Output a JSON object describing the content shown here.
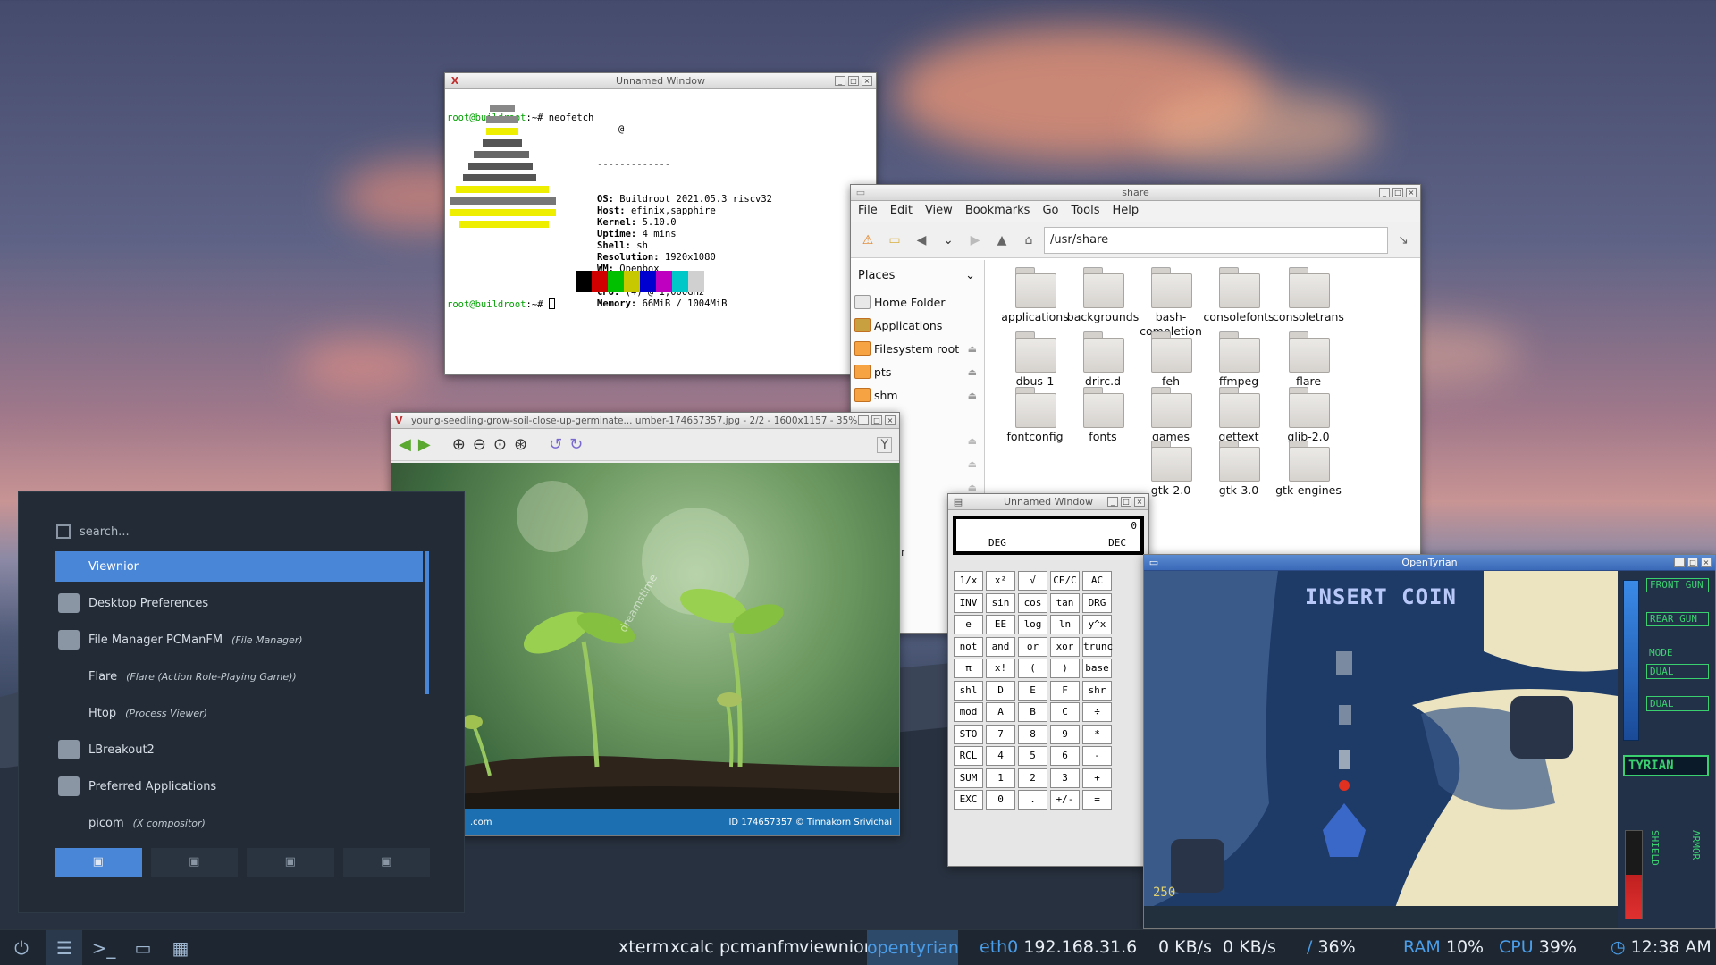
{
  "xterm": {
    "title": "Unnamed Window",
    "prompt1": "root@buildroot",
    "cmd1": ":~# neofetch",
    "at": "@",
    "sep": "-------------",
    "info": [
      [
        "OS:",
        "Buildroot 2021.05.3 riscv32"
      ],
      [
        "Host:",
        "efinix,sapphire"
      ],
      [
        "Kernel:",
        "5.10.0"
      ],
      [
        "Uptime:",
        "4 mins"
      ],
      [
        "Shell:",
        "sh"
      ],
      [
        "Resolution:",
        "1920x1080"
      ],
      [
        "WM:",
        "Openbox"
      ],
      [
        "Terminal:",
        "xterm"
      ],
      [
        "CPU:",
        "(4) @ 1,000GHz"
      ],
      [
        "Memory:",
        "66MiB / 1004MiB"
      ]
    ],
    "prompt2": "root@buildroot",
    "cmd2": ":~# ",
    "palette": [
      "#000000",
      "#d00000",
      "#00c000",
      "#c8c800",
      "#0000d0",
      "#c000c0",
      "#00c8c8",
      "#d0d0d0"
    ]
  },
  "filemanager": {
    "title": "share",
    "menu": [
      "File",
      "Edit",
      "View",
      "Bookmarks",
      "Go",
      "Tools",
      "Help"
    ],
    "path": "/usr/share",
    "places_label": "Places",
    "places": [
      "Home Folder",
      "Applications",
      "Filesystem root",
      "pts",
      "shm"
    ],
    "folders": [
      "applications",
      "backgrounds",
      "bash-\ncompletion",
      "consolefonts",
      "consoletrans",
      "dbus-1",
      "drirc.d",
      "feh",
      "ffmpeg",
      "flare",
      "fontconfig",
      "fonts",
      "games",
      "gettext",
      "glib-2.0",
      "",
      "",
      "gtk-2.0",
      "gtk-3.0",
      "gtk-engines"
    ],
    "partial_label": "r"
  },
  "viewnior": {
    "title": "young-seedling-grow-soil-close-up-germinate... umber-174657357.jpg - 2/2 - 1600x1157 - 35%",
    "watermark": "dreamstime",
    "bar_left": ".com",
    "bar_right": "ID 174657357 © Tinnakorn Srivichai"
  },
  "xcalc": {
    "title": "Unnamed Window",
    "display": "0",
    "deg": "DEG",
    "dec": "DEC",
    "rows": [
      [
        "1/x",
        "x²",
        "√",
        "CE/C",
        "AC"
      ],
      [
        "INV",
        "sin",
        "cos",
        "tan",
        "DRG"
      ],
      [
        "e",
        "EE",
        "log",
        "ln",
        "y^x"
      ],
      [
        "not",
        "and",
        "or",
        "xor",
        "trunc"
      ],
      [
        "π",
        "x!",
        "(",
        ")",
        "base"
      ],
      [
        "shl",
        "D",
        "E",
        "F",
        "shr"
      ],
      [
        "mod",
        "A",
        "B",
        "C",
        "÷"
      ],
      [
        "STO",
        "7",
        "8",
        "9",
        "*"
      ],
      [
        "RCL",
        "4",
        "5",
        "6",
        "-"
      ],
      [
        "SUM",
        "1",
        "2",
        "3",
        "+"
      ],
      [
        "EXC",
        "0",
        ".",
        "+/-",
        "="
      ]
    ]
  },
  "opentyrian": {
    "title": "OpenTyrian",
    "insert_coin": "INSERT COIN",
    "score": "250",
    "front_gun": "FRONT GUN",
    "rear_gun": "REAR GUN",
    "mode": "MODE",
    "dual1": "DUAL",
    "dual2": "DUAL",
    "ship": "TYRIAN",
    "shield": "SHIELD",
    "armor": "ARMOR"
  },
  "appmenu": {
    "search_placeholder": "search...",
    "items": [
      {
        "label": "Viewnior",
        "sub": ""
      },
      {
        "label": "Desktop Preferences",
        "sub": ""
      },
      {
        "label": "File Manager PCManFM",
        "sub": "(File Manager)"
      },
      {
        "label": "Flare",
        "sub": "(Flare (Action Role-Playing Game))"
      },
      {
        "label": "Htop",
        "sub": "(Process Viewer)"
      },
      {
        "label": "LBreakout2",
        "sub": ""
      },
      {
        "label": "Preferred Applications",
        "sub": ""
      },
      {
        "label": "picom",
        "sub": "(X compositor)"
      }
    ]
  },
  "taskbar": {
    "tasks": [
      "xterm",
      "xcalc",
      "pcmanfm",
      "viewnior",
      "opentyrian"
    ],
    "eth": "eth0",
    "ip": "192.168.31.6",
    "net": "0 KB/s  0 KB/s",
    "disk_label": "/",
    "disk": "36%",
    "ram_label": "RAM",
    "ram": "10%",
    "cpu_label": "CPU",
    "cpu": "39%",
    "time": "12:38 AM"
  },
  "colors": {
    "accent": "#4a86d8",
    "taskbar": "#1e2731",
    "menu_bg": "#222b36"
  }
}
